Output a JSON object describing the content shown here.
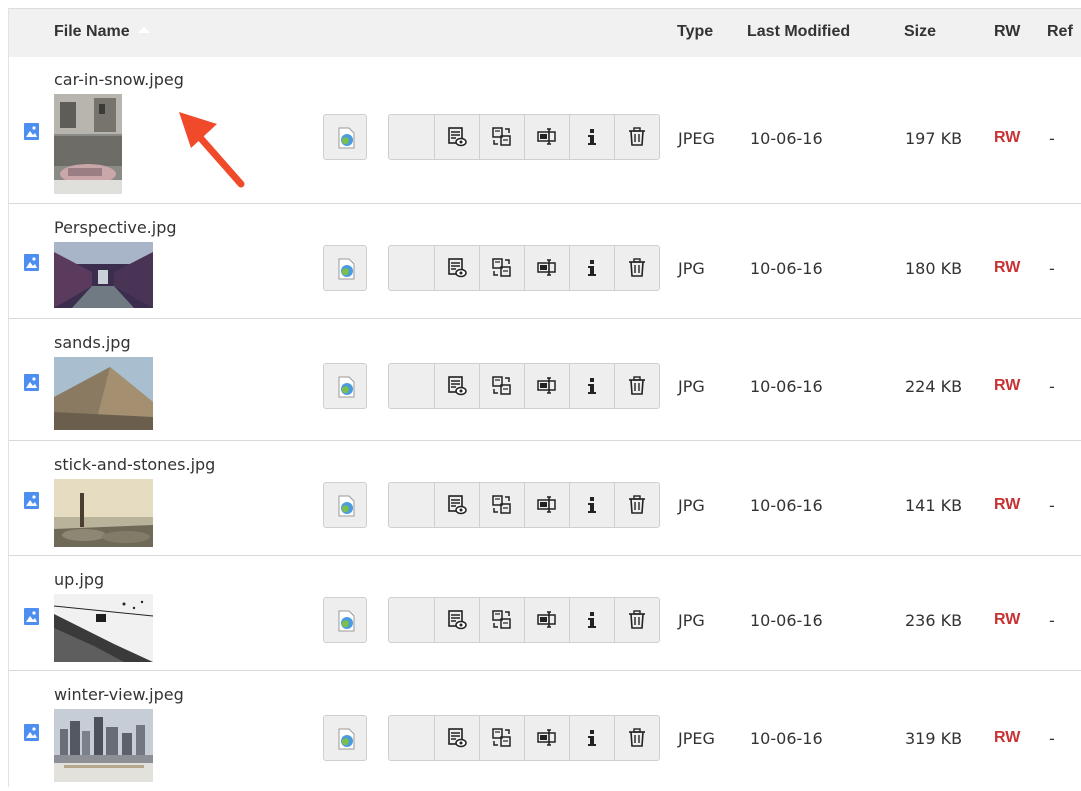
{
  "header": {
    "file_name": "File Name",
    "type": "Type",
    "last_modified": "Last Modified",
    "size": "Size",
    "rw": "RW",
    "ref": "Ref"
  },
  "files": [
    {
      "name": "car-in-snow.jpeg",
      "type": "JPEG",
      "modified": "10-06-16",
      "size": "197 KB",
      "rw": "RW",
      "ref": "-"
    },
    {
      "name": "Perspective.jpg",
      "type": "JPG",
      "modified": "10-06-16",
      "size": "180 KB",
      "rw": "RW",
      "ref": "-"
    },
    {
      "name": "sands.jpg",
      "type": "JPG",
      "modified": "10-06-16",
      "size": "224 KB",
      "rw": "RW",
      "ref": "-"
    },
    {
      "name": "stick-and-stones.jpg",
      "type": "JPG",
      "modified": "10-06-16",
      "size": "141 KB",
      "rw": "RW",
      "ref": "-"
    },
    {
      "name": "up.jpg",
      "type": "JPG",
      "modified": "10-06-16",
      "size": "236 KB",
      "rw": "RW",
      "ref": "-"
    },
    {
      "name": "winter-view.jpeg",
      "type": "JPEG",
      "modified": "10-06-16",
      "size": "319 KB",
      "rw": "RW",
      "ref": "-"
    }
  ],
  "icons": {
    "file_type": "image-file-icon",
    "web_view": "web-view-icon",
    "metadata": "edit-metadata-icon",
    "replace": "replace-file-icon",
    "rename": "rename-icon",
    "info": "info-icon",
    "delete": "trash-icon"
  },
  "colors": {
    "rw_accent": "#c83232",
    "file_icon": "#4d8ff0",
    "annotation_arrow": "#f04a2a"
  }
}
